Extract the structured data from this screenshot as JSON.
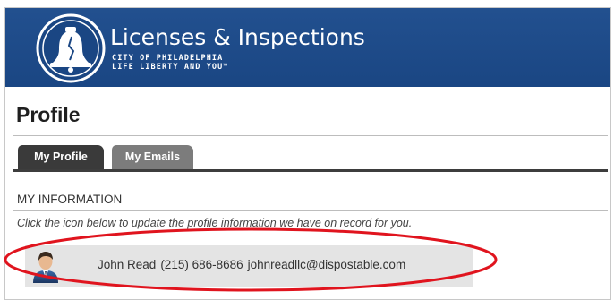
{
  "header": {
    "title": "Licenses & Inspections",
    "subtitle_line1": "CITY OF PHILADELPHIA",
    "subtitle_line2": "LIFE LIBERTY AND YOU™"
  },
  "page": {
    "title": "Profile"
  },
  "tabs": [
    {
      "label": "My Profile",
      "active": true
    },
    {
      "label": "My Emails",
      "active": false
    }
  ],
  "section": {
    "heading": "MY INFORMATION",
    "hint": "Click the icon below to update the profile information we have on record for you."
  },
  "profile": {
    "name": "John Read",
    "phone": "(215) 686-8686",
    "email": "johnreadllc@dispostable.com"
  },
  "colors": {
    "header_bg": "#1f4a87",
    "tab_active": "#3a3a3a",
    "tab_inactive": "#7c7c7c",
    "annotation": "#e0141e"
  },
  "icons": [
    "liberty-bell-logo",
    "user-avatar-icon"
  ]
}
